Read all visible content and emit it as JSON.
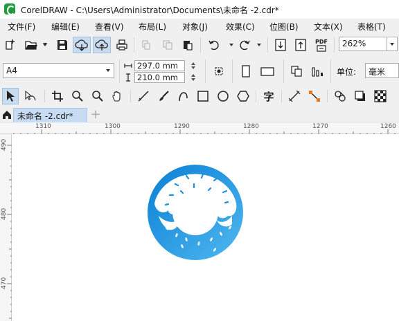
{
  "window": {
    "title": "CorelDRAW - C:\\Users\\Administrator\\Documents\\未命名 -2.cdr*"
  },
  "menu": [
    {
      "label": "文件(F)"
    },
    {
      "label": "编辑(E)"
    },
    {
      "label": "查看(V)"
    },
    {
      "label": "布局(L)"
    },
    {
      "label": "对象(J)"
    },
    {
      "label": "效果(C)"
    },
    {
      "label": "位图(B)"
    },
    {
      "label": "文本(X)"
    },
    {
      "label": "表格(T)"
    }
  ],
  "toolbar": {
    "zoom_value": "262%",
    "pdf_label": "PDF"
  },
  "property_bar": {
    "page_size": "A4",
    "width": "297.0 mm",
    "height": "210.0 mm",
    "unit_label": "单位:",
    "unit_value": "毫米"
  },
  "tools": {
    "text_tool_glyph": "字"
  },
  "tabs": {
    "document": "未命名 -2.cdr*",
    "add": "+"
  },
  "ruler": {
    "horizontal": [
      "1310",
      "1300",
      "1290",
      "1280",
      "1270",
      "1260"
    ],
    "vertical": [
      "490",
      "480",
      "470"
    ]
  },
  "colors": {
    "accent": "#c9dcef",
    "logo_green": "#1f9a3c",
    "donut_dark": "#0a7fd4",
    "donut_light": "#4fb8f0"
  }
}
